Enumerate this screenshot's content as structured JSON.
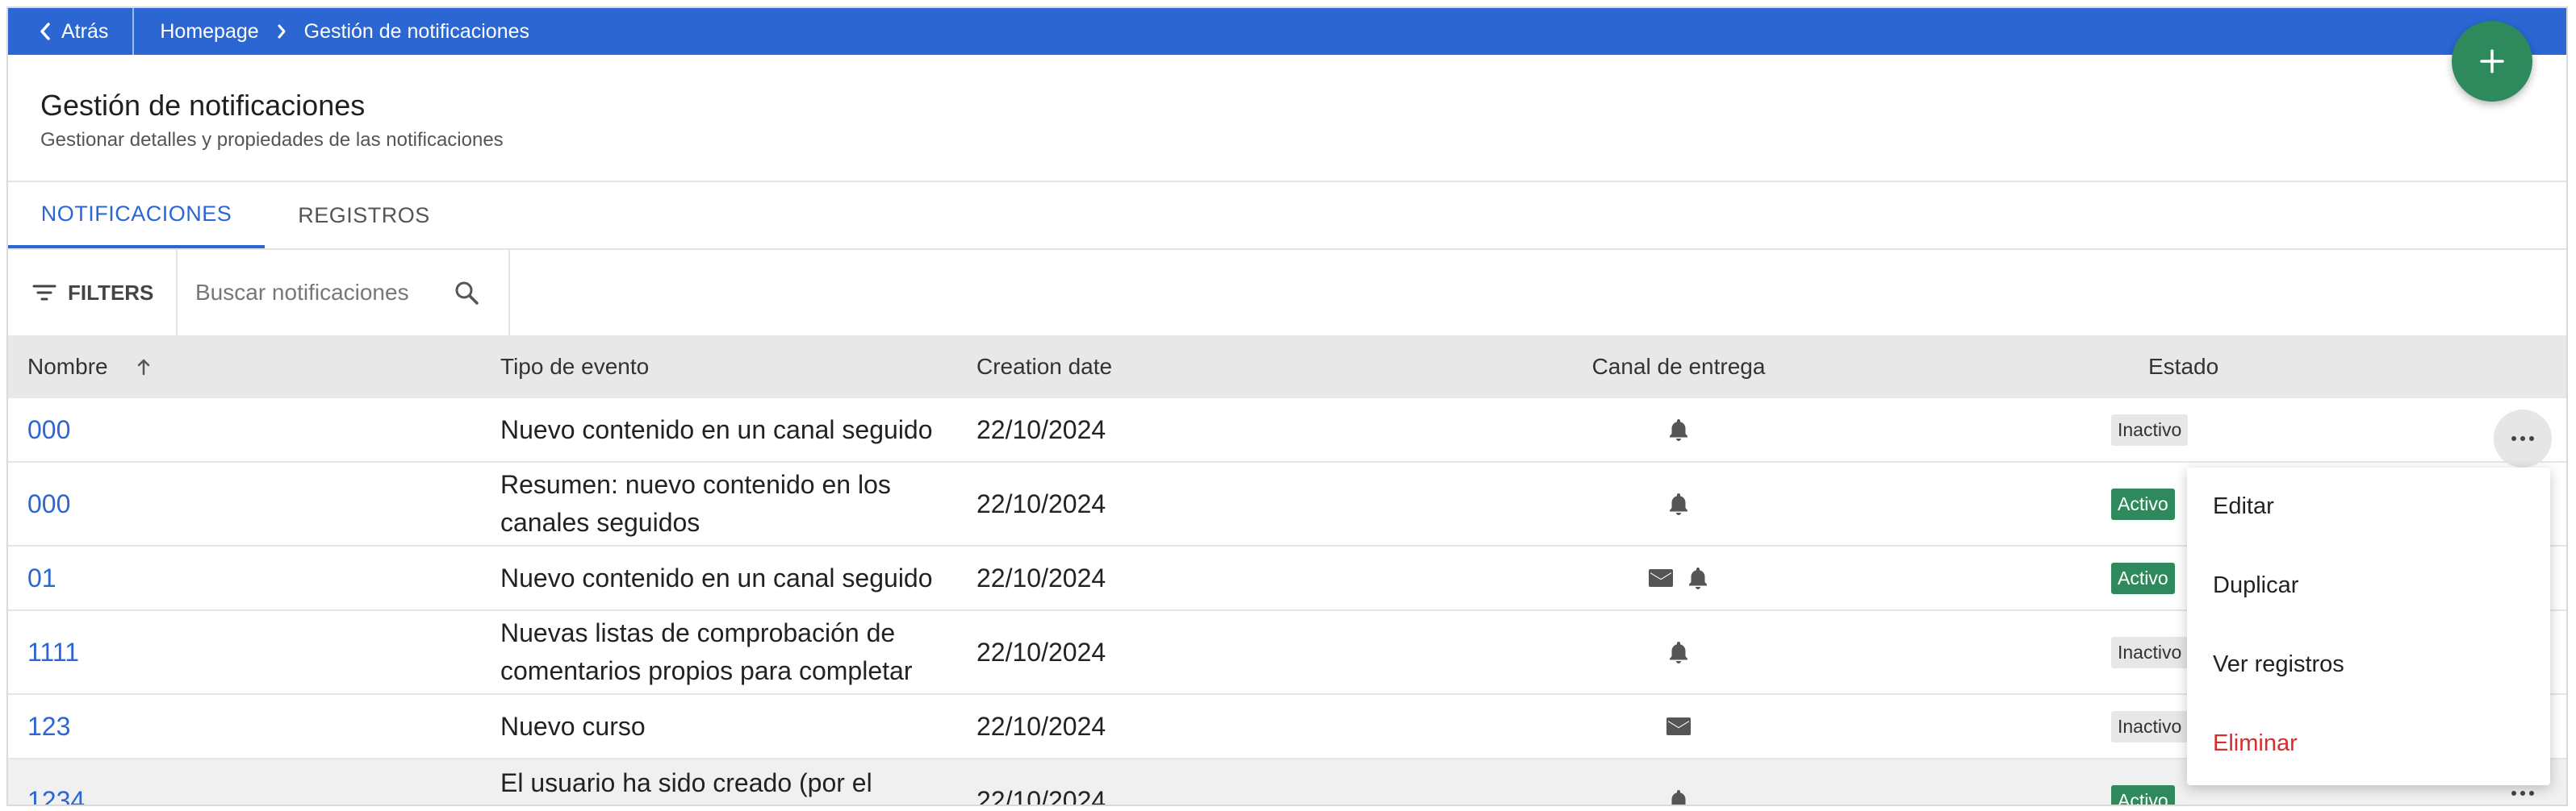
{
  "topbar": {
    "back_label": "Atrás",
    "breadcrumb": [
      "Homepage",
      "Gestión de notificaciones"
    ]
  },
  "header": {
    "title": "Gestión de notificaciones",
    "subtitle": "Gestionar detalles y propiedades de las notificaciones"
  },
  "tabs": [
    {
      "label": "NOTIFICACIONES",
      "active": true
    },
    {
      "label": "REGISTROS",
      "active": false
    }
  ],
  "toolbar": {
    "filters_label": "FILTERS",
    "search_placeholder": "Buscar notificaciones"
  },
  "table": {
    "columns": [
      "Nombre",
      "Tipo de evento",
      "Creation date",
      "Canal de entrega",
      "Estado"
    ],
    "sort": {
      "column": "Nombre",
      "direction": "ascending"
    },
    "rows": [
      {
        "name": "000",
        "event": "Nuevo contenido en un canal seguido",
        "date": "22/10/2024",
        "channels": [
          "bell"
        ],
        "state": "Inactivo"
      },
      {
        "name": "000",
        "event": "Resumen: nuevo contenido en los canales seguidos",
        "date": "22/10/2024",
        "channels": [
          "bell"
        ],
        "state": "Activo"
      },
      {
        "name": "01",
        "event": "Nuevo contenido en un canal seguido",
        "date": "22/10/2024",
        "channels": [
          "mail",
          "bell"
        ],
        "state": "Activo"
      },
      {
        "name": "1111",
        "event": "Nuevas listas de comprobación de comentarios propios para completar",
        "date": "22/10/2024",
        "channels": [
          "bell"
        ],
        "state": "Inactivo"
      },
      {
        "name": "123",
        "event": "Nuevo curso",
        "date": "22/10/2024",
        "channels": [
          "mail"
        ],
        "state": "Inactivo"
      },
      {
        "name": "1234",
        "event": "El usuario ha sido creado (por el",
        "date": "22/10/2024",
        "channels": [
          "bell"
        ],
        "state": "Activo"
      }
    ]
  },
  "row_menu": {
    "items": [
      {
        "label": "Editar"
      },
      {
        "label": "Duplicar"
      },
      {
        "label": "Ver registros"
      },
      {
        "label": "Eliminar",
        "danger": true
      }
    ]
  },
  "colors": {
    "primary": "#2b66d3",
    "success": "#2e8a5d",
    "danger": "#d32f2f",
    "inactive_badge": "#e7e7e7",
    "header_row": "#e8e8e8"
  },
  "icons": {
    "back": "chevron-left-icon",
    "separator": "chevron-right-icon",
    "fab": "plus-icon",
    "filters": "filter-icon",
    "search": "search-icon",
    "sort": "arrow-up-icon",
    "channel_bell": "bell-icon",
    "channel_mail": "mail-icon",
    "row_menu": "more-horizontal-icon"
  }
}
